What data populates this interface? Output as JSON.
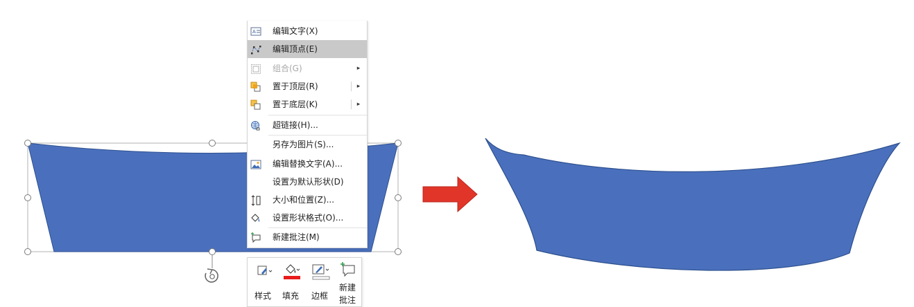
{
  "context_menu": {
    "items": [
      {
        "label": "编辑文字(X)",
        "icon": "edit-text-icon"
      },
      {
        "label": "编辑顶点(E)",
        "icon": "edit-points-icon",
        "highlighted": true
      },
      {
        "label": "组合(G)",
        "icon": "group-icon",
        "disabled": true
      },
      {
        "label": "置于顶层(R)",
        "icon": "bring-to-front-icon"
      },
      {
        "label": "置于底层(K)",
        "icon": "send-to-back-icon"
      },
      {
        "label": "超链接(H)...",
        "icon": "hyperlink-icon"
      },
      {
        "label": "另存为图片(S)...",
        "icon": ""
      },
      {
        "label": "编辑替换文字(A)...",
        "icon": "alt-text-icon"
      },
      {
        "label": "设置为默认形状(D)",
        "icon": ""
      },
      {
        "label": "大小和位置(Z)...",
        "icon": "size-position-icon"
      },
      {
        "label": "设置形状格式(O)...",
        "icon": "format-shape-icon"
      },
      {
        "label": "新建批注(M)",
        "icon": "new-comment-icon"
      }
    ],
    "submenu_arrow": "▸"
  },
  "mini_toolbar": {
    "style_label": "样式",
    "fill_label": "填充",
    "border_label": "边框",
    "new_comment_label_1": "新建",
    "new_comment_label_2": "批注",
    "fill_color": "#e81c1c"
  },
  "colors": {
    "shape_fill": "#4a70bd",
    "shape_stroke": "#2c4f8e",
    "arrow_fill": "#e2352a",
    "arrow_stroke": "#b8281f",
    "highlight": "#c9c9c9"
  }
}
